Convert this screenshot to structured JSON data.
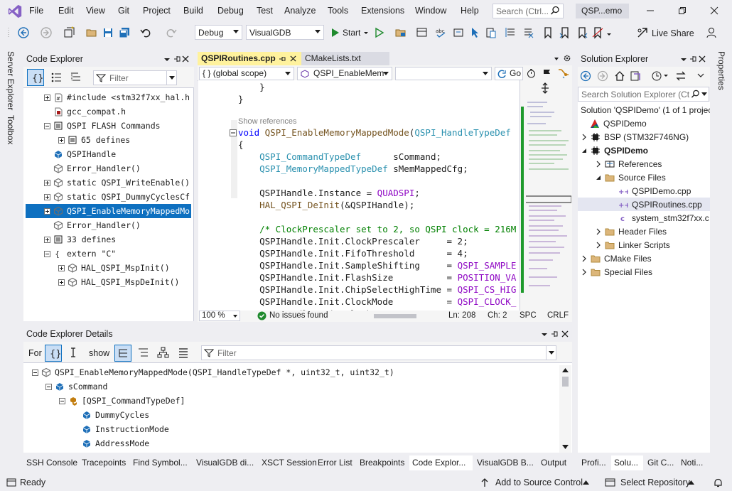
{
  "menu": [
    "File",
    "Edit",
    "View",
    "Git",
    "Project",
    "Build",
    "Debug",
    "Test",
    "Analyze",
    "Tools",
    "Extensions",
    "Window",
    "Help"
  ],
  "search": {
    "placeholder": "Search (Ctrl..."
  },
  "title": "QSP...emo",
  "toolbar": {
    "config": "Debug",
    "platform": "VisualGDB",
    "start": "Start",
    "live_share": "Live Share"
  },
  "side_tabs": {
    "left": [
      "Server Explorer",
      "Toolbox"
    ],
    "right": [
      "Properties"
    ]
  },
  "code_explorer": {
    "title": "Code Explorer",
    "filter_placeholder": "Filter",
    "items": [
      {
        "label": "#include <stm32f7xx_hal.h",
        "expand": "plus",
        "icon": "include-icon"
      },
      {
        "label": "gcc_compat.h",
        "expand": "",
        "icon": "file-icon"
      },
      {
        "label": "QSPI FLASH Commands",
        "expand": "minus",
        "icon": "region-icon"
      },
      {
        "label": "65 defines",
        "expand": "plus",
        "icon": "define-icon",
        "indent": 1
      },
      {
        "label": "QSPIHandle",
        "expand": "",
        "icon": "variable-icon"
      },
      {
        "label": "Error_Handler()",
        "expand": "",
        "icon": "function-icon"
      },
      {
        "label": "static QSPI_WriteEnable()",
        "expand": "plus",
        "icon": "function-icon"
      },
      {
        "label": "static QSPI_DummyCyclesCf",
        "expand": "plus",
        "icon": "function-icon"
      },
      {
        "label": "QSPI_EnableMemoryMappedMo",
        "expand": "plus",
        "icon": "function-icon",
        "selected": true
      },
      {
        "label": "Error_Handler()",
        "expand": "",
        "icon": "function-icon"
      },
      {
        "label": "33 defines",
        "expand": "plus",
        "icon": "define-icon"
      },
      {
        "label": "extern \"C\"",
        "expand": "minus",
        "icon": "brace-icon"
      },
      {
        "label": "HAL_QSPI_MspInit()",
        "expand": "plus",
        "icon": "function-icon",
        "indent": 1
      },
      {
        "label": "HAL_QSPI_MspDeInit()",
        "expand": "plus",
        "icon": "function-icon",
        "indent": 1
      }
    ]
  },
  "editor": {
    "tabs": [
      {
        "label": "QSPIRoutines.cpp",
        "active": true
      },
      {
        "label": "CMakeLists.txt",
        "active": false
      }
    ],
    "scope": "(global scope)",
    "scope_prefix": "{ }",
    "member": "QSPI_EnableMem",
    "go_label": "Go",
    "show_references": "Show references",
    "zoom": "100 %",
    "issues": "No issues found",
    "line": "Ln: 208",
    "col": "Ch: 2",
    "spc": "SPC",
    "eol": "CRLF"
  },
  "code_lines": [
    [
      {
        "t": "    }",
        "c": ""
      }
    ],
    [
      {
        "t": "}",
        "c": ""
      }
    ],
    [
      {
        "t": "",
        "c": ""
      }
    ],
    [
      {
        "t": "void ",
        "c": "kw"
      },
      {
        "t": "QSPI_EnableMemoryMappedMode",
        "c": "fn"
      },
      {
        "t": "(",
        "c": ""
      },
      {
        "t": "QSPI_HandleTypeDef",
        "c": "ty"
      }
    ],
    [
      {
        "t": "{",
        "c": ""
      }
    ],
    [
      {
        "t": "    ",
        "c": ""
      },
      {
        "t": "QSPI_CommandTypeDef",
        "c": "ty"
      },
      {
        "t": "      sCommand;",
        "c": ""
      }
    ],
    [
      {
        "t": "    ",
        "c": ""
      },
      {
        "t": "QSPI_MemoryMappedTypeDef",
        "c": "ty"
      },
      {
        "t": " sMemMappedCfg;",
        "c": ""
      }
    ],
    [
      {
        "t": "",
        "c": ""
      }
    ],
    [
      {
        "t": "    QSPIHandle.Instance = ",
        "c": ""
      },
      {
        "t": "QUADSPI",
        "c": "mac"
      },
      {
        "t": ";",
        "c": ""
      }
    ],
    [
      {
        "t": "    ",
        "c": ""
      },
      {
        "t": "HAL_QSPI_DeInit",
        "c": "fn"
      },
      {
        "t": "(&QSPIHandle);",
        "c": ""
      }
    ],
    [
      {
        "t": "",
        "c": ""
      }
    ],
    [
      {
        "t": "    /* ClockPrescaler set to 2, so QSPI clock = 216M",
        "c": "cm"
      }
    ],
    [
      {
        "t": "    QSPIHandle.Init.ClockPrescaler     = 2;",
        "c": ""
      }
    ],
    [
      {
        "t": "    QSPIHandle.Init.FifoThreshold      = 4;",
        "c": ""
      }
    ],
    [
      {
        "t": "    QSPIHandle.Init.SampleShifting     = ",
        "c": ""
      },
      {
        "t": "QSPI_SAMPLE",
        "c": "mac"
      }
    ],
    [
      {
        "t": "    QSPIHandle.Init.FlashSize          = ",
        "c": ""
      },
      {
        "t": "POSITION_VA",
        "c": "mac"
      }
    ],
    [
      {
        "t": "    QSPIHandle.Init.ChipSelectHighTime = ",
        "c": ""
      },
      {
        "t": "QSPI_CS_HIG",
        "c": "mac"
      }
    ],
    [
      {
        "t": "    QSPIHandle.Init.ClockMode          = ",
        "c": ""
      },
      {
        "t": "QSPI_CLOCK_",
        "c": "mac"
      }
    ],
    [
      {
        "t": "    QSPIHandle.Init.FlashID            = ",
        "c": ""
      },
      {
        "t": "QSPI_FLASH_",
        "c": "mac"
      }
    ]
  ],
  "solution_explorer": {
    "title": "Solution Explorer",
    "search_placeholder": "Search Solution Explorer (Ct",
    "items": [
      {
        "label": "Solution 'QSPIDemo' (1 of 1 projec",
        "indent": 0,
        "icon": "",
        "expand": ""
      },
      {
        "label": "QSPIDemo",
        "indent": 0,
        "icon": "cmake-icon",
        "expand": ""
      },
      {
        "label": "BSP (STM32F746NG)",
        "indent": 0,
        "icon": "chip-icon",
        "expand": "right"
      },
      {
        "label": "QSPIDemo",
        "indent": 0,
        "icon": "chip-icon",
        "expand": "down",
        "bold": true
      },
      {
        "label": "References",
        "indent": 1,
        "icon": "references-icon",
        "expand": "right"
      },
      {
        "label": "Source Files",
        "indent": 1,
        "icon": "folder-icon",
        "expand": "down"
      },
      {
        "label": "QSPIDemo.cpp",
        "indent": 2,
        "icon": "cpp-icon",
        "expand": ""
      },
      {
        "label": "QSPIRoutines.cpp",
        "indent": 2,
        "icon": "cpp-icon",
        "expand": "",
        "highlight": true
      },
      {
        "label": "system_stm32f7xx.c",
        "indent": 2,
        "icon": "c-icon",
        "expand": ""
      },
      {
        "label": "Header Files",
        "indent": 1,
        "icon": "folder-icon",
        "expand": "right"
      },
      {
        "label": "Linker Scripts",
        "indent": 1,
        "icon": "folder-icon",
        "expand": "right"
      },
      {
        "label": "CMake Files",
        "indent": 0,
        "icon": "folder-icon",
        "expand": "right"
      },
      {
        "label": "Special Files",
        "indent": 0,
        "icon": "folder-icon",
        "expand": "right"
      }
    ],
    "bottom_tabs": [
      "Profi...",
      "Solu...",
      "Git C...",
      "Noti..."
    ]
  },
  "details": {
    "title": "Code Explorer Details",
    "for_label": "For",
    "show_label": "show",
    "filter_placeholder": "Filter",
    "items": [
      {
        "label": "QSPI_EnableMemoryMappedMode(QSPI_HandleTypeDef *, uint32_t, uint32_t)",
        "indent": 0,
        "icon": "function-icon",
        "expand": "minus"
      },
      {
        "label": "sCommand",
        "indent": 1,
        "icon": "variable-icon",
        "expand": "minus"
      },
      {
        "label": "[QSPI_CommandTypeDef]",
        "indent": 2,
        "icon": "type-icon",
        "expand": "minus"
      },
      {
        "label": "DummyCycles",
        "indent": 3,
        "icon": "field-icon",
        "expand": ""
      },
      {
        "label": "InstructionMode",
        "indent": 3,
        "icon": "field-icon",
        "expand": ""
      },
      {
        "label": "AddressMode",
        "indent": 3,
        "icon": "field-icon",
        "expand": ""
      }
    ]
  },
  "bottom_tabs": [
    "SSH Console",
    "Tracepoints",
    "Find Symbol...",
    "VisualGDB di...",
    "XSCT Session",
    "Error List",
    "Breakpoints",
    "Code Explor...",
    "VisualGDB B...",
    "Output"
  ],
  "status": {
    "ready": "Ready",
    "source_control": "Add to Source Control",
    "repository": "Select Repository"
  },
  "colors": {
    "accent": "#0e70c0",
    "active_tab": "#fff29d",
    "status_bar": "#eeeef2",
    "vs_purple": "#8661c5"
  }
}
